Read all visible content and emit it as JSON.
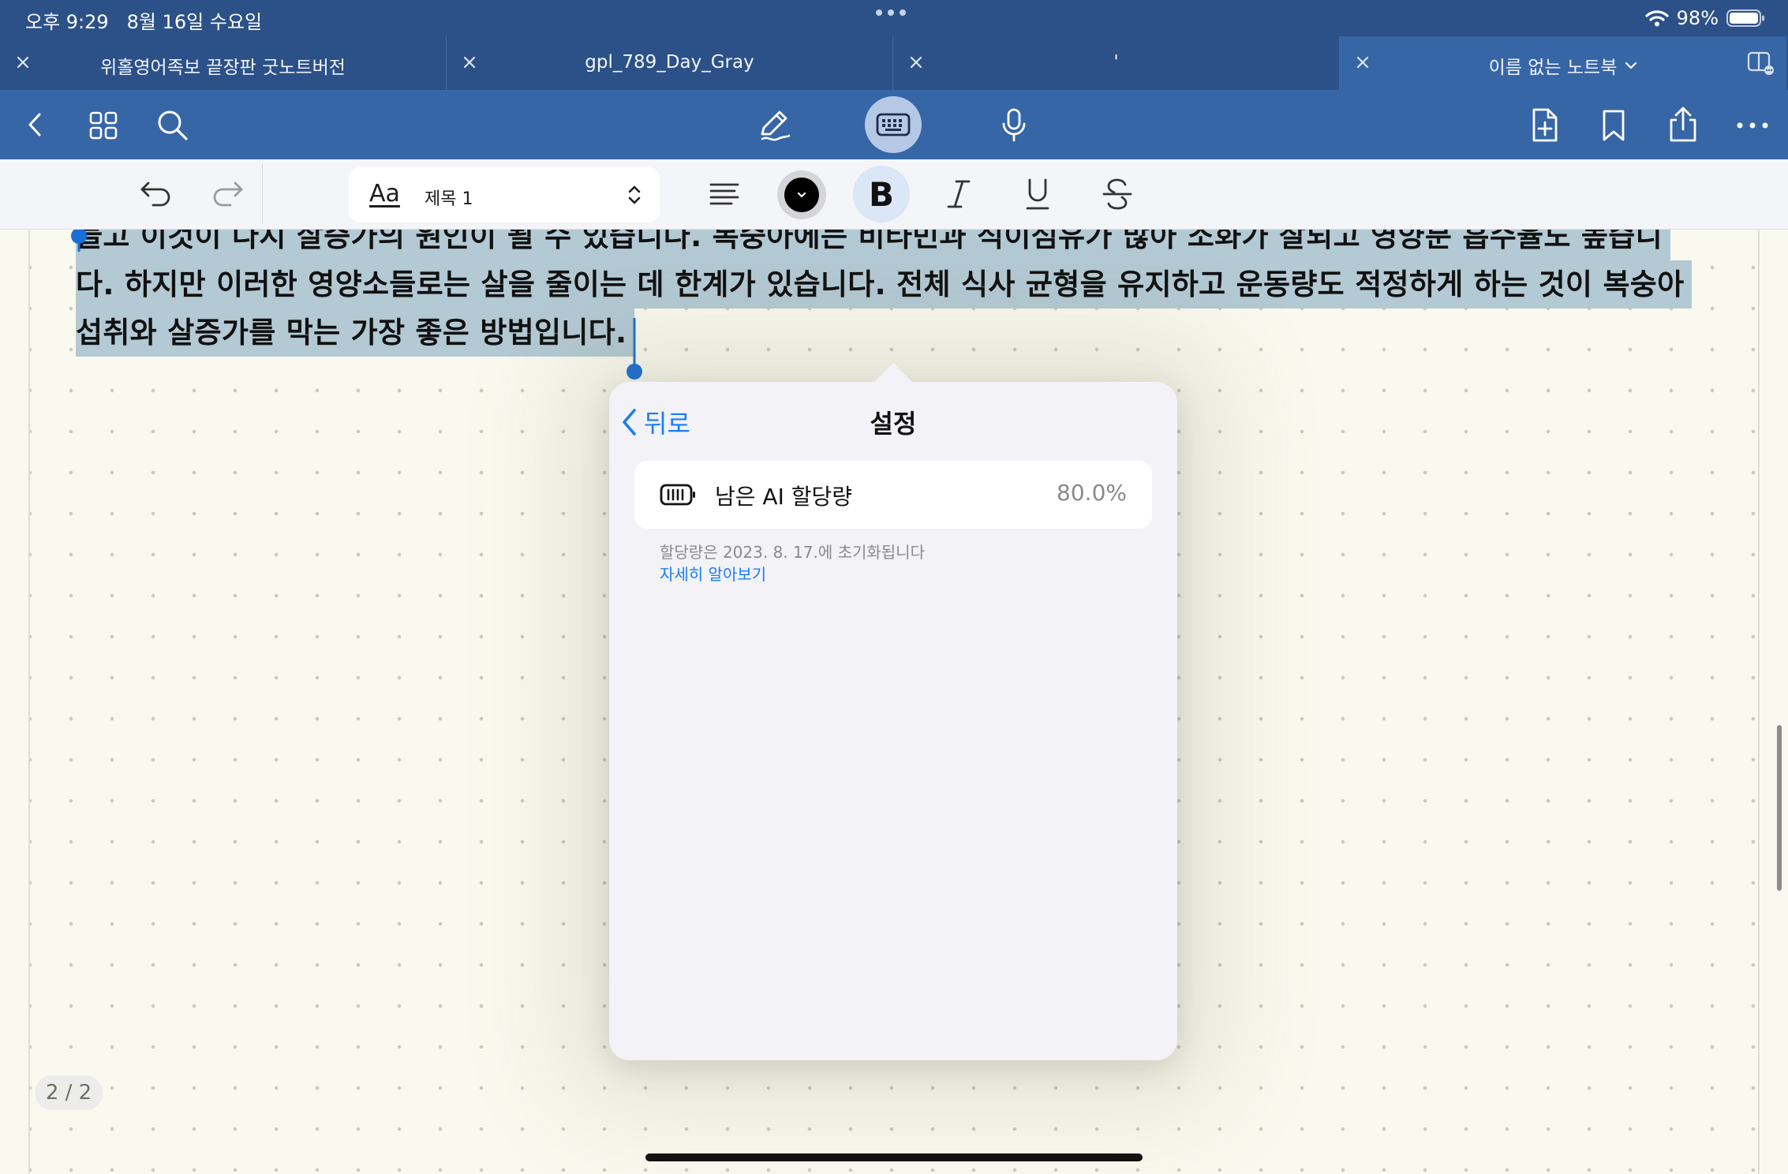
{
  "status_bar": {
    "time": "오후 9:29",
    "date": "8월 16일 수요일",
    "battery": "98%",
    "icons": [
      "wifi-icon",
      "battery-icon"
    ]
  },
  "tabs": [
    {
      "title": "위홀영어족보 끝장판 굿노트버전",
      "active": false
    },
    {
      "title": "gpl_789_Day_Gray",
      "active": false
    },
    {
      "title": "'",
      "active": false
    },
    {
      "title": "이름 없는 노트북",
      "active": true
    }
  ],
  "toolbar": {
    "left_icons": [
      "back-icon",
      "thumbnails-icon",
      "search-icon"
    ],
    "center_icons": [
      "pen-icon",
      "keyboard-icon",
      "microphone-icon"
    ],
    "right_icons": [
      "add-page-icon",
      "bookmark-icon",
      "share-icon",
      "more-icon"
    ]
  },
  "format_toolbar": {
    "style_icon_text": "Aa",
    "style_name": "제목 1",
    "text_color": "#000000",
    "bold_label": "B",
    "bold_active": true,
    "icons": [
      "undo-icon",
      "redo-icon",
      "align-icon",
      "italic-icon",
      "underline-icon",
      "strikethrough-icon"
    ]
  },
  "note": {
    "lines": [
      "늘고 이것이 다시 살증가의 원인이 될 수 있습니다. 복숭아에는 비타민과 식이섬유가 많아 소화가 잘되고 영양분 흡수율도 높습니",
      "다. 하지만 이러한 영양소들로는 살을 줄이는 데 한계가 있습니다. 전체 식사 균형을 유지하고 운동량도 적정하게 하는 것이 복숭아",
      "섭취와 살증가를 막는 가장 좋은 방법입니다."
    ],
    "page_indicator": "2 / 2"
  },
  "popover": {
    "back_label": "뒤로",
    "title": "설정",
    "quota_label": "남은 AI 할당량",
    "quota_value": "80.0%",
    "reset_note": "할당량은 2023. 8. 17.에 초기화됩니다",
    "learn_more": "자세히 알아보기"
  },
  "colors": {
    "accent": "#1a7cf5",
    "toolbar": "#3766a7",
    "status_bar": "#2c5188",
    "selection": "#b3c9d4"
  }
}
